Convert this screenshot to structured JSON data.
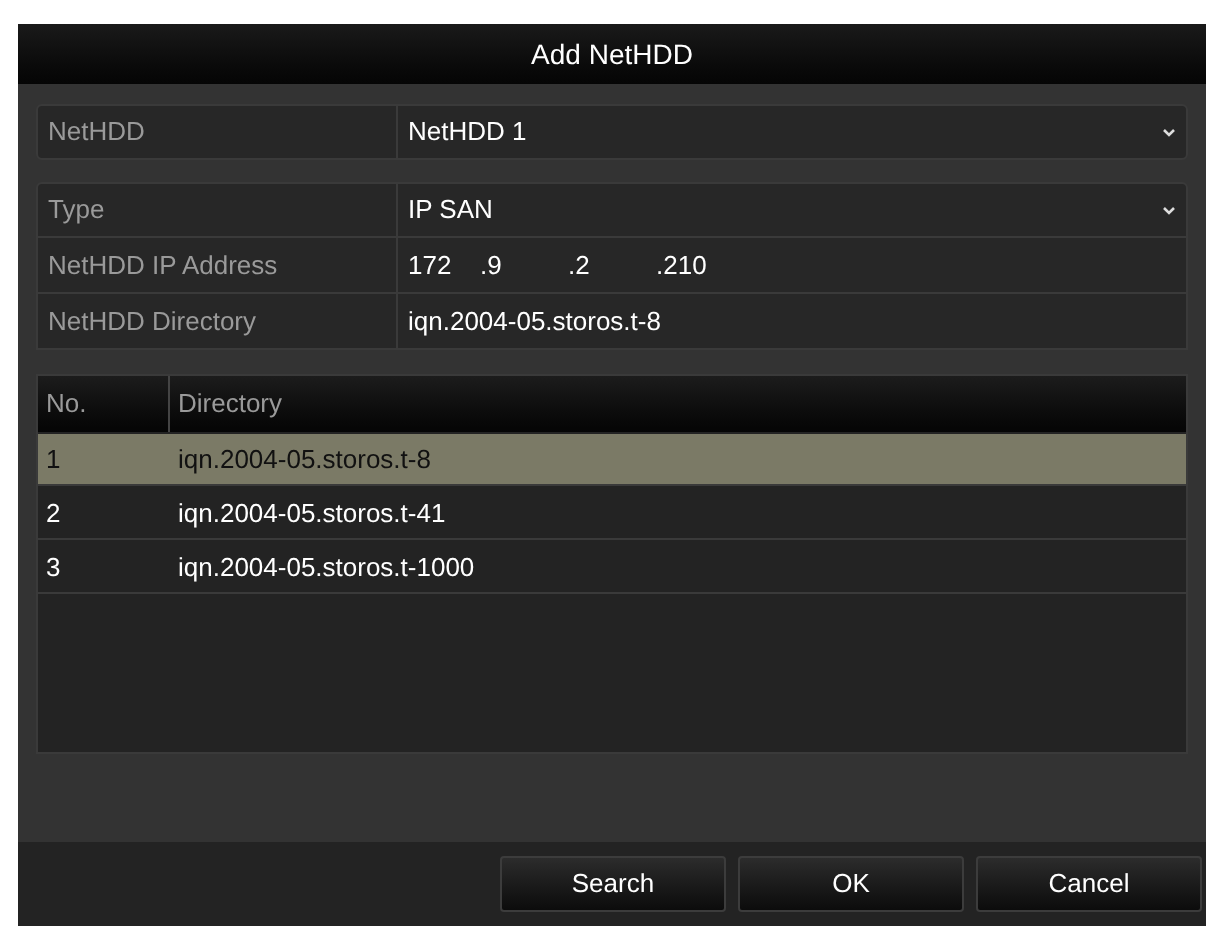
{
  "dialog": {
    "title": "Add NetHDD"
  },
  "fields": [
    {
      "label": "NetHDD",
      "kind": "dropdown",
      "value": "NetHDD 1"
    },
    {
      "label": "Type",
      "kind": "dropdown",
      "value": "IP SAN"
    },
    {
      "label": "NetHDD IP Address",
      "kind": "ip",
      "segments": [
        "172",
        ".9",
        ".2",
        ".210"
      ]
    },
    {
      "label": "NetHDD Directory",
      "kind": "text",
      "value": "iqn.2004-05.storos.t-8"
    }
  ],
  "table": {
    "columns": [
      "No.",
      "Directory"
    ],
    "rows": [
      {
        "cells": [
          "1",
          "iqn.2004-05.storos.t-8"
        ],
        "selected": true
      },
      {
        "cells": [
          "2",
          "iqn.2004-05.storos.t-41"
        ],
        "selected": false
      },
      {
        "cells": [
          "3",
          "iqn.2004-05.storos.t-1000"
        ],
        "selected": false
      }
    ]
  },
  "buttons": [
    "Search",
    "OK",
    "Cancel"
  ]
}
